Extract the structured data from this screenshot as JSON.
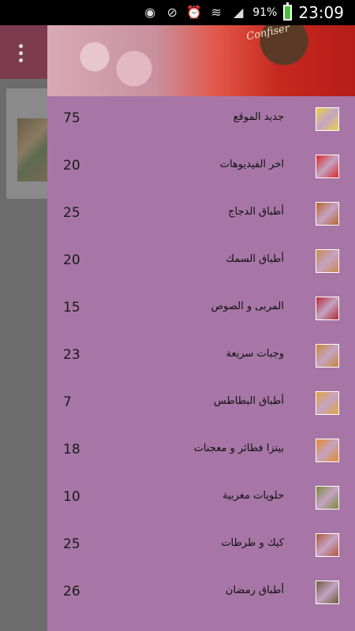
{
  "status_bar": {
    "battery_percent": "91%",
    "time": "23:09",
    "icons": [
      "eye-icon",
      "no-sim-icon",
      "alarm-icon",
      "wifi-icon",
      "signal-icon",
      "battery-icon"
    ]
  },
  "header": {
    "logo_text": "Confiser"
  },
  "drawer_items": [
    {
      "label": "جديد الموقع",
      "count": "75",
      "icon": "new-badge-icon",
      "color": "#e9d24a"
    },
    {
      "label": "اخر الفيديوهات",
      "count": "20",
      "icon": "youtube-icon",
      "color": "#d8282a"
    },
    {
      "label": "أطباق الدجاج",
      "count": "25",
      "icon": "chicken-dish-icon",
      "color": "#b8662c"
    },
    {
      "label": "أطباق السمك",
      "count": "20",
      "icon": "fish-dish-icon",
      "color": "#c98a4a"
    },
    {
      "label": "المربى و الصوص",
      "count": "15",
      "icon": "jam-sauce-icon",
      "color": "#b32a36"
    },
    {
      "label": "وجبات سريعة",
      "count": "23",
      "icon": "fast-food-icon",
      "color": "#c8873a"
    },
    {
      "label": "أطباق البطاطس",
      "count": "7",
      "icon": "fries-icon",
      "color": "#e0a63c"
    },
    {
      "label": "بيتزا فطائر و معجنات",
      "count": "18",
      "icon": "pizza-icon",
      "color": "#e58a2a"
    },
    {
      "label": "حلويات مغربية",
      "count": "10",
      "icon": "moroccan-sweets-icon",
      "color": "#7a8a3a"
    },
    {
      "label": "كيك و طرطات",
      "count": "25",
      "icon": "cake-icon",
      "color": "#b0573a"
    },
    {
      "label": "أطباق رمضان",
      "count": "26",
      "icon": "ramadan-dish-icon",
      "color": "#6e5a3a"
    }
  ]
}
